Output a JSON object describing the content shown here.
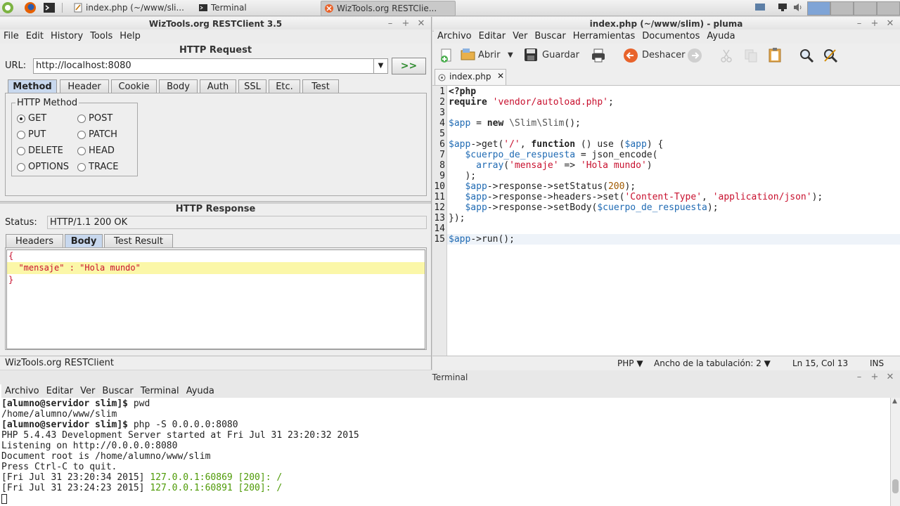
{
  "taskbar": {
    "tasks": [
      {
        "label": "index.php (~/www/sli..."
      },
      {
        "label": "Terminal"
      },
      {
        "label": "WizTools.org RESTClie..."
      }
    ]
  },
  "restclient": {
    "title": "WizTools.org RESTClient 3.5",
    "menu": [
      "File",
      "Edit",
      "History",
      "Tools",
      "Help"
    ],
    "request_title": "HTTP Request",
    "url_label": "URL:",
    "url_value": "http://localhost:8080",
    "go_label": ">>",
    "request_tabs": [
      "Method",
      "Header",
      "Cookie",
      "Body",
      "Auth",
      "SSL",
      "Etc.",
      "Test"
    ],
    "method_group_label": "HTTP Method",
    "methods": [
      "GET",
      "POST",
      "PUT",
      "PATCH",
      "DELETE",
      "HEAD",
      "OPTIONS",
      "TRACE"
    ],
    "selected_method": "GET",
    "response_title": "HTTP Response",
    "status_label": "Status:",
    "status_value": "HTTP/1.1 200 OK",
    "response_tabs": [
      "Headers",
      "Body",
      "Test Result"
    ],
    "body_lines": [
      "{",
      "  \"mensaje\" : \"Hola mundo\"",
      "}"
    ],
    "statusbar": "WizTools.org RESTClient"
  },
  "pluma": {
    "title": "index.php (~/www/slim) - pluma",
    "menu": [
      "Archivo",
      "Editar",
      "Ver",
      "Buscar",
      "Herramientas",
      "Documentos",
      "Ayuda"
    ],
    "toolbar": {
      "open": "Abrir",
      "save": "Guardar",
      "undo": "Deshacer"
    },
    "tab": "index.php",
    "line_numbers": [
      "1",
      "2",
      "3",
      "4",
      "5",
      "6",
      "7",
      "8",
      "9",
      "10",
      "11",
      "12",
      "13",
      "14",
      "15"
    ],
    "status": {
      "language": "PHP",
      "tab_width": "Ancho de la tabulación:  2",
      "position": "Ln 15, Col 13",
      "mode": "INS"
    }
  },
  "terminal": {
    "title": "Terminal",
    "menu": [
      "Archivo",
      "Editar",
      "Ver",
      "Buscar",
      "Terminal",
      "Ayuda"
    ],
    "lines": [
      {
        "prompt": "[alumno@servidor slim]$",
        "text": " pwd"
      },
      {
        "text": "/home/alumno/www/slim"
      },
      {
        "prompt": "[alumno@servidor slim]$",
        "text": " php -S 0.0.0.0:8080"
      },
      {
        "text": "PHP 5.4.43 Development Server started at Fri Jul 31 23:20:32 2015"
      },
      {
        "text": "Listening on http://0.0.0.0:8080"
      },
      {
        "text": "Document root is /home/alumno/www/slim"
      },
      {
        "text": "Press Ctrl-C to quit."
      },
      {
        "text": "[Fri Jul 31 23:20:34 2015] ",
        "green": "127.0.0.1:60869 [200]: /"
      },
      {
        "text": "[Fri Jul 31 23:24:23 2015] ",
        "green": "127.0.0.1:60891 [200]: /"
      }
    ]
  }
}
